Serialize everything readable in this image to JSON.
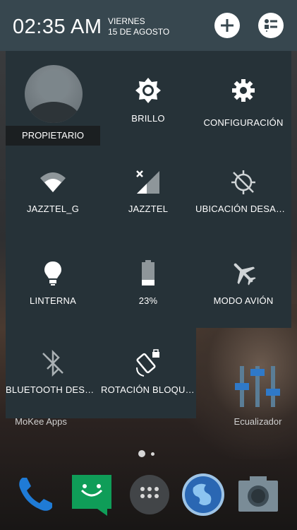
{
  "header": {
    "time": "02:35 AM",
    "day": "VIERNES",
    "date": "15 DE AGOSTO",
    "add_icon": "plus-icon",
    "settings_list_icon": "settings-list-icon"
  },
  "user": {
    "label": "PROPIETARIO"
  },
  "tiles": [
    {
      "label": "BRILLO",
      "icon": "brightness-icon"
    },
    {
      "label": "CONFIGURACIÓN",
      "icon": "gear-icon"
    },
    {
      "label": "JAZZTEL_G",
      "icon": "wifi-icon"
    },
    {
      "label": "JAZZTEL",
      "icon": "cell-signal-icon"
    },
    {
      "label": "UBICACIÓN DESACTIVADA",
      "icon": "location-off-icon"
    },
    {
      "label": "LINTERNA",
      "icon": "flashlight-icon"
    },
    {
      "label": "23%",
      "icon": "battery-icon"
    },
    {
      "label": "MODO AVIÓN",
      "icon": "airplane-icon"
    },
    {
      "label": "BLUETOOTH DESACTIVADO",
      "icon": "bluetooth-off-icon"
    },
    {
      "label": "ROTACIÓN BLOQUEADA",
      "icon": "rotation-lock-icon"
    }
  ],
  "home": {
    "app1_label": "MoKee Apps",
    "app2_label": "Ecualizador",
    "dock": [
      "phone-icon",
      "messages-icon",
      "app-drawer-icon",
      "browser-icon",
      "camera-icon"
    ]
  },
  "battery_level": 0.23
}
